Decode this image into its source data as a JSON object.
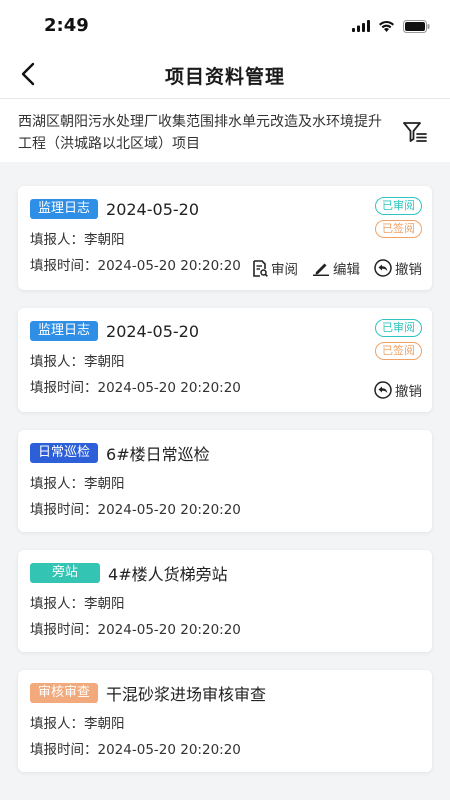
{
  "status_bar": {
    "time": "2:49"
  },
  "nav": {
    "title": "项目资料管理"
  },
  "project": {
    "name": "西湖区朝阳污水处理厂收集范围排水单元改造及水环境提升工程（洪城路以北区域）项目"
  },
  "labels": {
    "reporter_prefix": "填报人：",
    "time_prefix": "填报时间：",
    "review": "审阅",
    "edit": "编辑",
    "revoke": "撤销"
  },
  "colors": {
    "supervision": "#2f8ee6",
    "inspection": "#2d5fd8",
    "sideline": "#33c4b3",
    "audit": "#f2a97b",
    "reviewed": "#2ec4c0",
    "signed": "#f0a266"
  },
  "records": [
    {
      "tag": "监理日志",
      "tag_color": "#2f8ee6",
      "title": "2024-05-20",
      "reporter": "李朝阳",
      "time": "2024-05-20 20:20:20",
      "badges": [
        "已审阅",
        "已签阅"
      ],
      "actions": [
        "审阅",
        "编辑",
        "撤销"
      ]
    },
    {
      "tag": "监理日志",
      "tag_color": "#2f8ee6",
      "title": "2024-05-20",
      "reporter": "李朝阳",
      "time": "2024-05-20 20:20:20",
      "badges": [
        "已审阅",
        "已签阅"
      ],
      "actions": [
        "撤销"
      ]
    },
    {
      "tag": "日常巡检",
      "tag_color": "#2d5fd8",
      "title": "6#楼日常巡检",
      "reporter": "李朝阳",
      "time": "2024-05-20 20:20:20",
      "badges": [],
      "actions": []
    },
    {
      "tag": "旁站",
      "tag_color": "#33c4b3",
      "title": "4#楼人货梯旁站",
      "reporter": "李朝阳",
      "time": "2024-05-20 20:20:20",
      "badges": [],
      "actions": []
    },
    {
      "tag": "审核审查",
      "tag_color": "#f2a97b",
      "title": "干混砂浆进场审核审查",
      "reporter": "李朝阳",
      "time": "2024-05-20 20:20:20",
      "badges": [],
      "actions": []
    }
  ]
}
